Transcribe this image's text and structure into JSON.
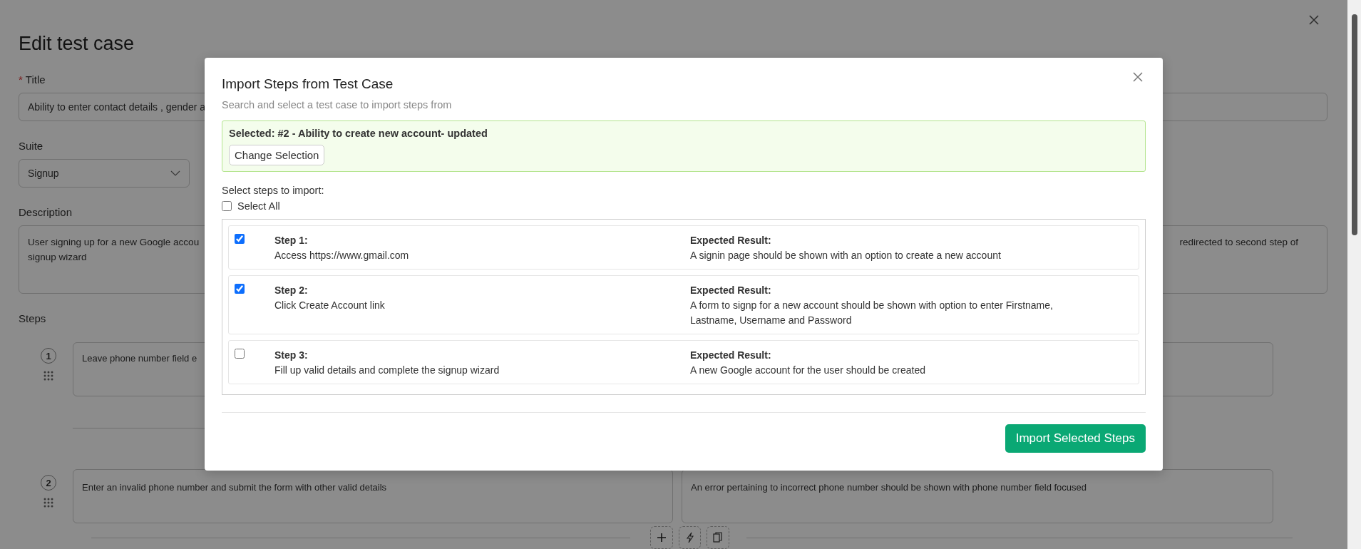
{
  "page": {
    "title": "Edit test case",
    "title_field": {
      "label": "Title",
      "required_mark": "*",
      "value": "Ability to enter contact details , gender a"
    },
    "suite_field": {
      "label": "Suite",
      "value": "Signup"
    },
    "description_field": {
      "label": "Description",
      "left_lines": [
        "User signing up for a new Google accou",
        "signup wizard"
      ],
      "right_text": "redirected to second step of"
    },
    "steps_label": "Steps",
    "steps": [
      {
        "number": "1",
        "action": "Leave phone number field e"
      },
      {
        "number": "2",
        "action": "Enter an invalid phone number and submit the form with other valid details",
        "expected": "An error pertaining to incorrect phone number should be shown with phone number field focused"
      }
    ]
  },
  "modal": {
    "title": "Import Steps from Test Case",
    "subtitle": "Search and select a test case to import steps from",
    "selected_text": "Selected: #2 - Ability to create new account- updated",
    "change_button": "Change Selection",
    "select_prompt": "Select steps to import:",
    "select_all": {
      "label": "Select All",
      "checked": false
    },
    "steps": [
      {
        "label": "Step 1:",
        "action": "Access https://www.gmail.com",
        "expected_label": "Expected Result:",
        "expected": "A signin page should be shown with an option to create a new account",
        "checked": true
      },
      {
        "label": "Step 2:",
        "action": "Click Create Account link",
        "expected_label": "Expected Result:",
        "expected": "A form to signp for a new account should be shown with option to enter Firstname, Lastname, Username and Password",
        "checked": true
      },
      {
        "label": "Step 3:",
        "action": "Fill up valid details and complete the signup wizard",
        "expected_label": "Expected Result:",
        "expected": "A new Google account for the user should be created",
        "checked": false
      }
    ],
    "import_button": "Import Selected Steps"
  }
}
